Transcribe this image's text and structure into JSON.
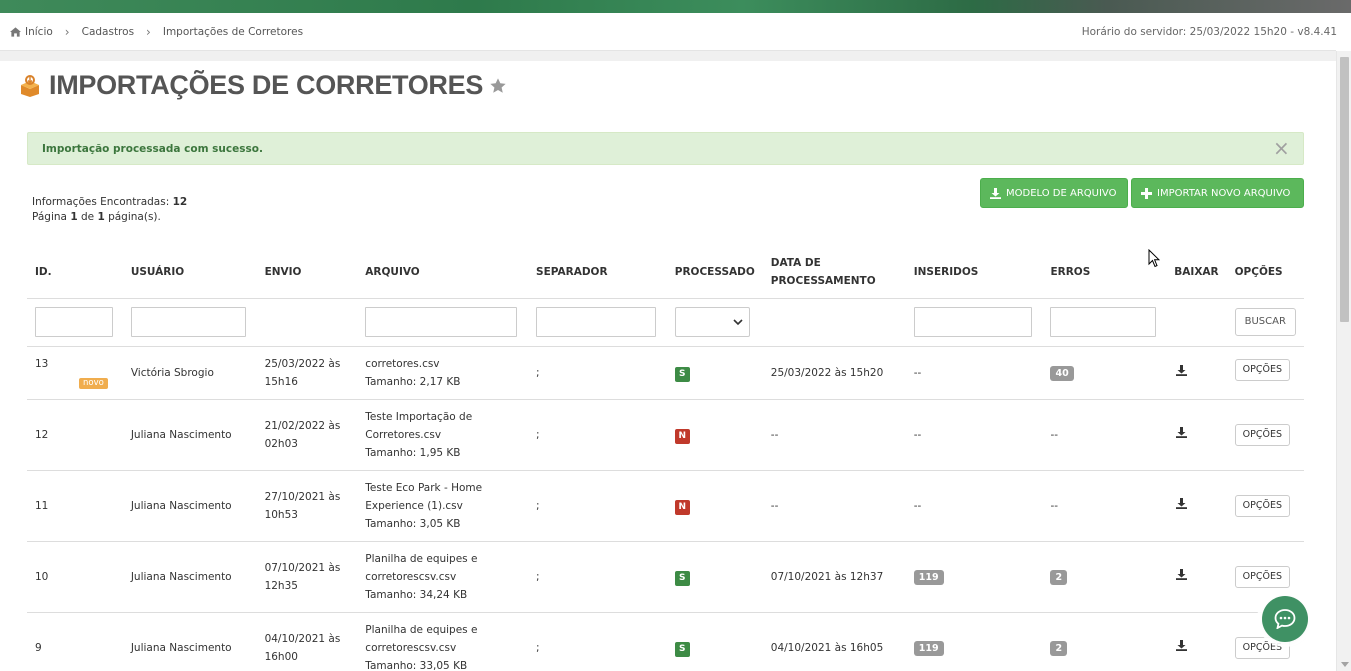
{
  "breadcrumb": {
    "home": "Início",
    "level1": "Cadastros",
    "level2": "Importações de Corretores"
  },
  "server_time": "Horário do servidor: 25/03/2022 15h20 - v8.4.41",
  "page": {
    "title": "IMPORTAÇÕES DE CORRETORES"
  },
  "alert": {
    "text": "Importação processada com sucesso.",
    "close": "×"
  },
  "info": {
    "found_label": "Informações Encontradas: ",
    "found_count": "12",
    "page_prefix": "Página ",
    "page_current": "1",
    "page_mid": " de ",
    "page_total": "1",
    "page_suffix": " página(s)."
  },
  "buttons": {
    "modelo": "MODELO DE ARQUIVO",
    "importar": "IMPORTAR NOVO ARQUIVO",
    "buscar": "BUSCAR"
  },
  "columns": {
    "id": "ID.",
    "usuario": "USUÁRIO",
    "envio": "ENVIO",
    "arquivo": "ARQUIVO",
    "separador": "SEPARADOR",
    "processado": "PROCESSADO",
    "data_line1": "DATA DE",
    "data_line2": "PROCESSAMENTO",
    "inseridos": "INSERIDOS",
    "erros": "ERROS",
    "baixar": "BAIXAR",
    "opcoes": "OPÇÕES"
  },
  "rows": [
    {
      "id": "13",
      "badge": "novo",
      "usuario": "Victória Sbrogio",
      "envio_1": "25/03/2022 às",
      "envio_2": "15h16",
      "arquivo_1": "corretores.csv",
      "arquivo_2": "",
      "tamanho": "Tamanho: 2,17 KB",
      "separador": ";",
      "processado": "S",
      "data": "25/03/2022 às 15h20",
      "inseridos": "--",
      "erros": "40",
      "opcoes": "OPÇÕES"
    },
    {
      "id": "12",
      "badge": "",
      "usuario": "Juliana Nascimento",
      "envio_1": "21/02/2022 às",
      "envio_2": "02h03",
      "arquivo_1": "Teste Importação de",
      "arquivo_2": "Corretores.csv",
      "tamanho": "Tamanho: 1,95 KB",
      "separador": ";",
      "processado": "N",
      "data": "--",
      "inseridos": "--",
      "erros": "--",
      "opcoes": "OPÇÕES"
    },
    {
      "id": "11",
      "badge": "",
      "usuario": "Juliana Nascimento",
      "envio_1": "27/10/2021 às",
      "envio_2": "10h53",
      "arquivo_1": "Teste Eco Park - Home",
      "arquivo_2": "Experience (1).csv",
      "tamanho": "Tamanho: 3,05 KB",
      "separador": ";",
      "processado": "N",
      "data": "--",
      "inseridos": "--",
      "erros": "--",
      "opcoes": "OPÇÕES"
    },
    {
      "id": "10",
      "badge": "",
      "usuario": "Juliana Nascimento",
      "envio_1": "07/10/2021 às",
      "envio_2": "12h35",
      "arquivo_1": "Planilha de equipes e",
      "arquivo_2": "corretorescsv.csv",
      "tamanho": "Tamanho: 34,24 KB",
      "separador": ";",
      "processado": "S",
      "data": "07/10/2021 às 12h37",
      "inseridos": "119",
      "erros": "2",
      "opcoes": "OPÇÕES"
    },
    {
      "id": "9",
      "badge": "",
      "usuario": "Juliana Nascimento",
      "envio_1": "04/10/2021 às",
      "envio_2": "16h00",
      "arquivo_1": "Planilha de equipes e",
      "arquivo_2": "corretorescsv.csv",
      "tamanho": "Tamanho: 33,05 KB",
      "separador": ";",
      "processado": "S",
      "data": "04/10/2021 às 16h05",
      "inseridos": "119",
      "erros": "2",
      "opcoes": "OPÇÕES"
    }
  ],
  "colors": {
    "accent_green": "#5cb85c",
    "status_s": "#3d8b45",
    "status_n": "#c0392b",
    "badge_novo": "#f0ad4e",
    "alert_bg": "#dff0d8"
  },
  "icons": {
    "home": "home-icon",
    "title": "import-box-icon",
    "star": "star-icon",
    "download": "download-icon",
    "plus": "plus-icon",
    "chat": "chat-bubble-icon"
  }
}
